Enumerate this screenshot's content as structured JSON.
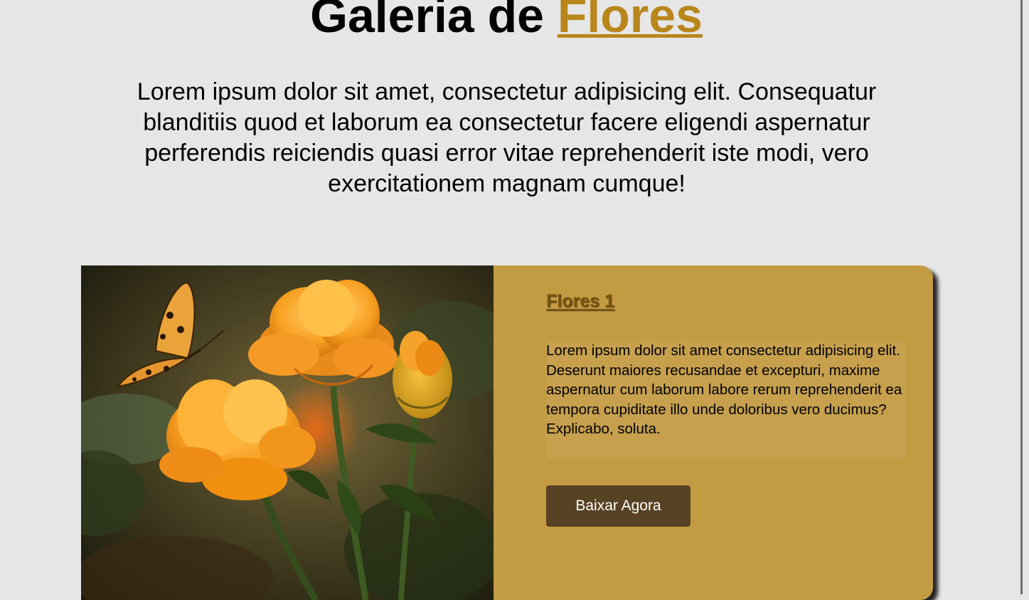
{
  "header": {
    "title_main": "Galeria de ",
    "title_accent": "Flores",
    "intro": "Lorem ipsum dolor sit amet, consectetur adipisicing elit. Consequatur blanditiis quod et laborum ea consectetur facere eligendi aspernatur perferendis reiciendis quasi error vitae reprehenderit iste modi, vero exercitationem magnam cumque!"
  },
  "card": {
    "title": "Flores 1",
    "text": "Lorem ipsum dolor sit amet consectetur adipisicing elit. Deserunt maiores recusandae et excepturi, maxime aspernatur cum laborum labore rerum reprehenderit ea tempora cupiditate illo unde doloribus vero ducimus? Explicabo, soluta.",
    "button_label": "Baixar Agora",
    "image_subject": "flower-photo"
  },
  "colors": {
    "page_background": "#e6e6e6",
    "accent": "#b8861b",
    "card_background": "#c39b42",
    "card_title": "#7a5711",
    "button_background": "#574223",
    "button_text": "#ffffff"
  }
}
